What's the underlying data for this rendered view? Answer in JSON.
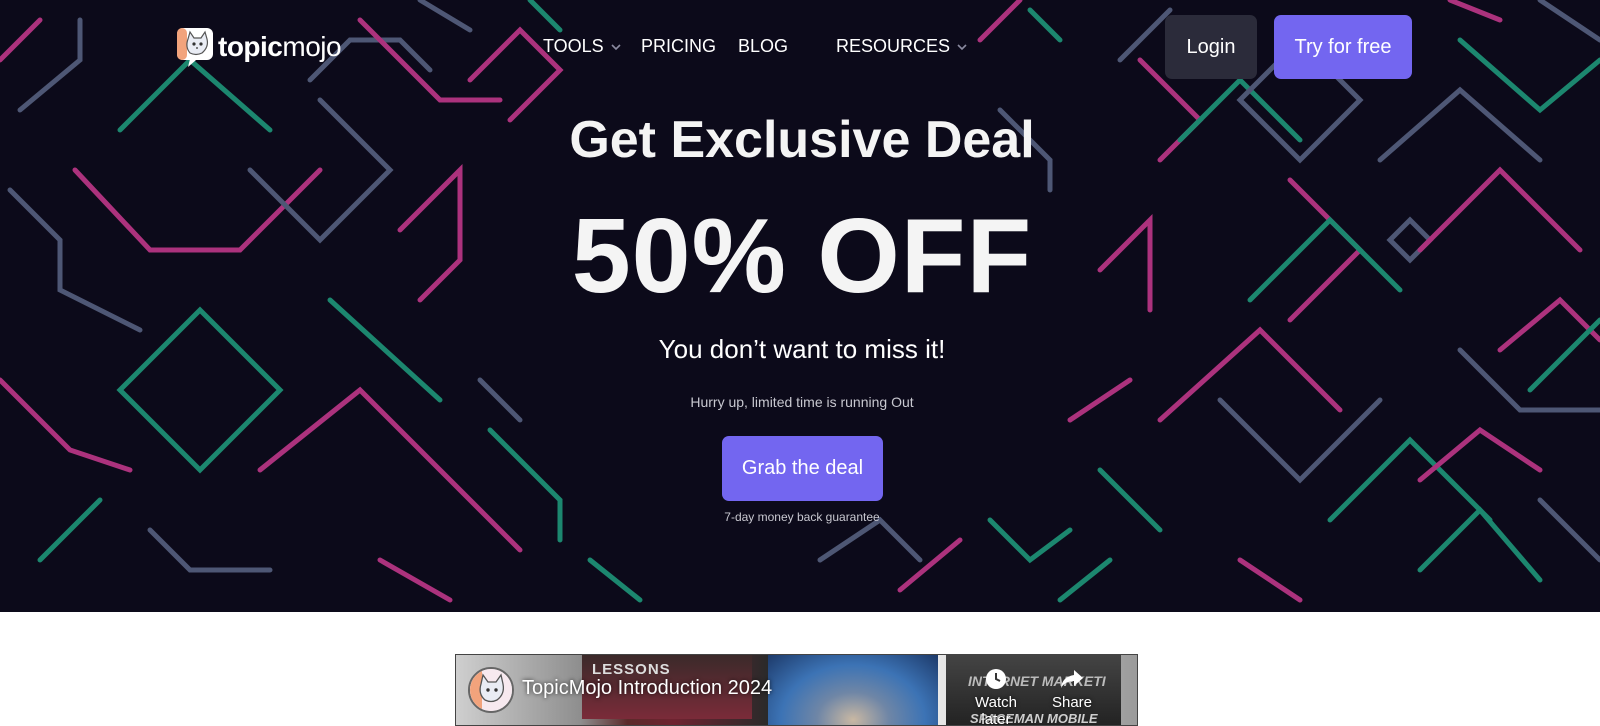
{
  "header": {
    "logo": {
      "bold": "topic",
      "light": "mojo"
    },
    "nav": [
      {
        "label": "TOOLS",
        "dropdown": true
      },
      {
        "label": "PRICING",
        "dropdown": false
      },
      {
        "label": "BLOG",
        "dropdown": false
      },
      {
        "label": "RESOURCES",
        "dropdown": true
      }
    ],
    "login_label": "Login",
    "try_label": "Try for free"
  },
  "hero": {
    "title": "Get Exclusive Deal",
    "discount": "50% OFF",
    "subtitle": "You don’t want to miss it!",
    "hurry": "Hurry up, limited time is running Out",
    "cta_label": "Grab the deal",
    "guarantee": "7-day money back guarantee"
  },
  "video": {
    "title": "TopicMojo Introduction 2024",
    "watch_later_label": "Watch later",
    "share_label": "Share",
    "thumbnail_texts": [
      "LESSONS",
      "INTERNET MARKETI",
      "SPACEMAN MOBILE"
    ]
  },
  "colors": {
    "accent": "#7366f0",
    "hero_bg": "#0c0a1a",
    "login_bg": "#2b2b3a",
    "pattern_pink": "#c93a8f",
    "pattern_teal": "#1f9d7e",
    "pattern_slate": "#5a6585"
  }
}
